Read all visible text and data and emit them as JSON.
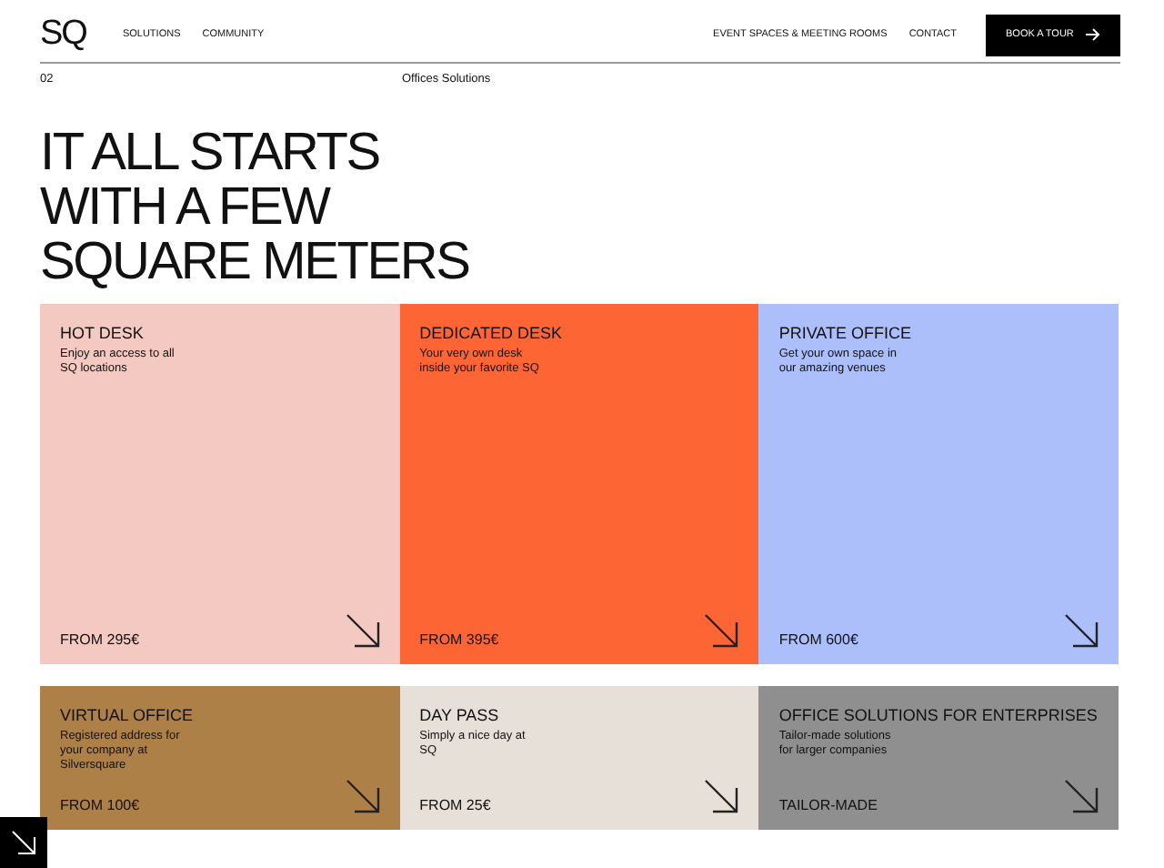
{
  "nav": {
    "logo": "SQ",
    "left_links": [
      "SOLUTIONS",
      "COMMUNITY"
    ],
    "right_links": [
      "EVENT SPACES & MEETING ROOMS",
      "CONTACT"
    ],
    "cta": "BOOK A TOUR"
  },
  "section": {
    "number": "02",
    "label": "Offices Solutions"
  },
  "headline": "IT ALL STARTS\nWITH A FEW\nSQUARE METERS",
  "card_rows": [
    [
      {
        "title": "HOT DESK",
        "description": "Enjoy an access to all\nSQ locations",
        "price": "FROM 295€",
        "color": "#f3c9c2"
      },
      {
        "title": "DEDICATED DESK",
        "description": "Your very own desk\ninside your favorite SQ",
        "price": "FROM 395€",
        "color": "#fd6634"
      },
      {
        "title": "PRIVATE OFFICE",
        "description": "Get your own space in\nour amazing venues",
        "price": "FROM 600€",
        "color": "#adbffa"
      }
    ],
    [
      {
        "title": "VIRTUAL OFFICE",
        "description": "Registered address for\nyour company at\nSilversquare",
        "price": "FROM 100€",
        "color": "#ad8048"
      },
      {
        "title": "DAY PASS",
        "description": "Simply a nice day at\nSQ",
        "price": "FROM 25€",
        "color": "#e6e0d8"
      },
      {
        "title": "OFFICE SOLUTIONS FOR ENTERPRISES",
        "description": "Tailor-made solutions\nfor larger companies",
        "price": "TAILOR-MADE",
        "color": "#8f8f8f"
      }
    ]
  ]
}
